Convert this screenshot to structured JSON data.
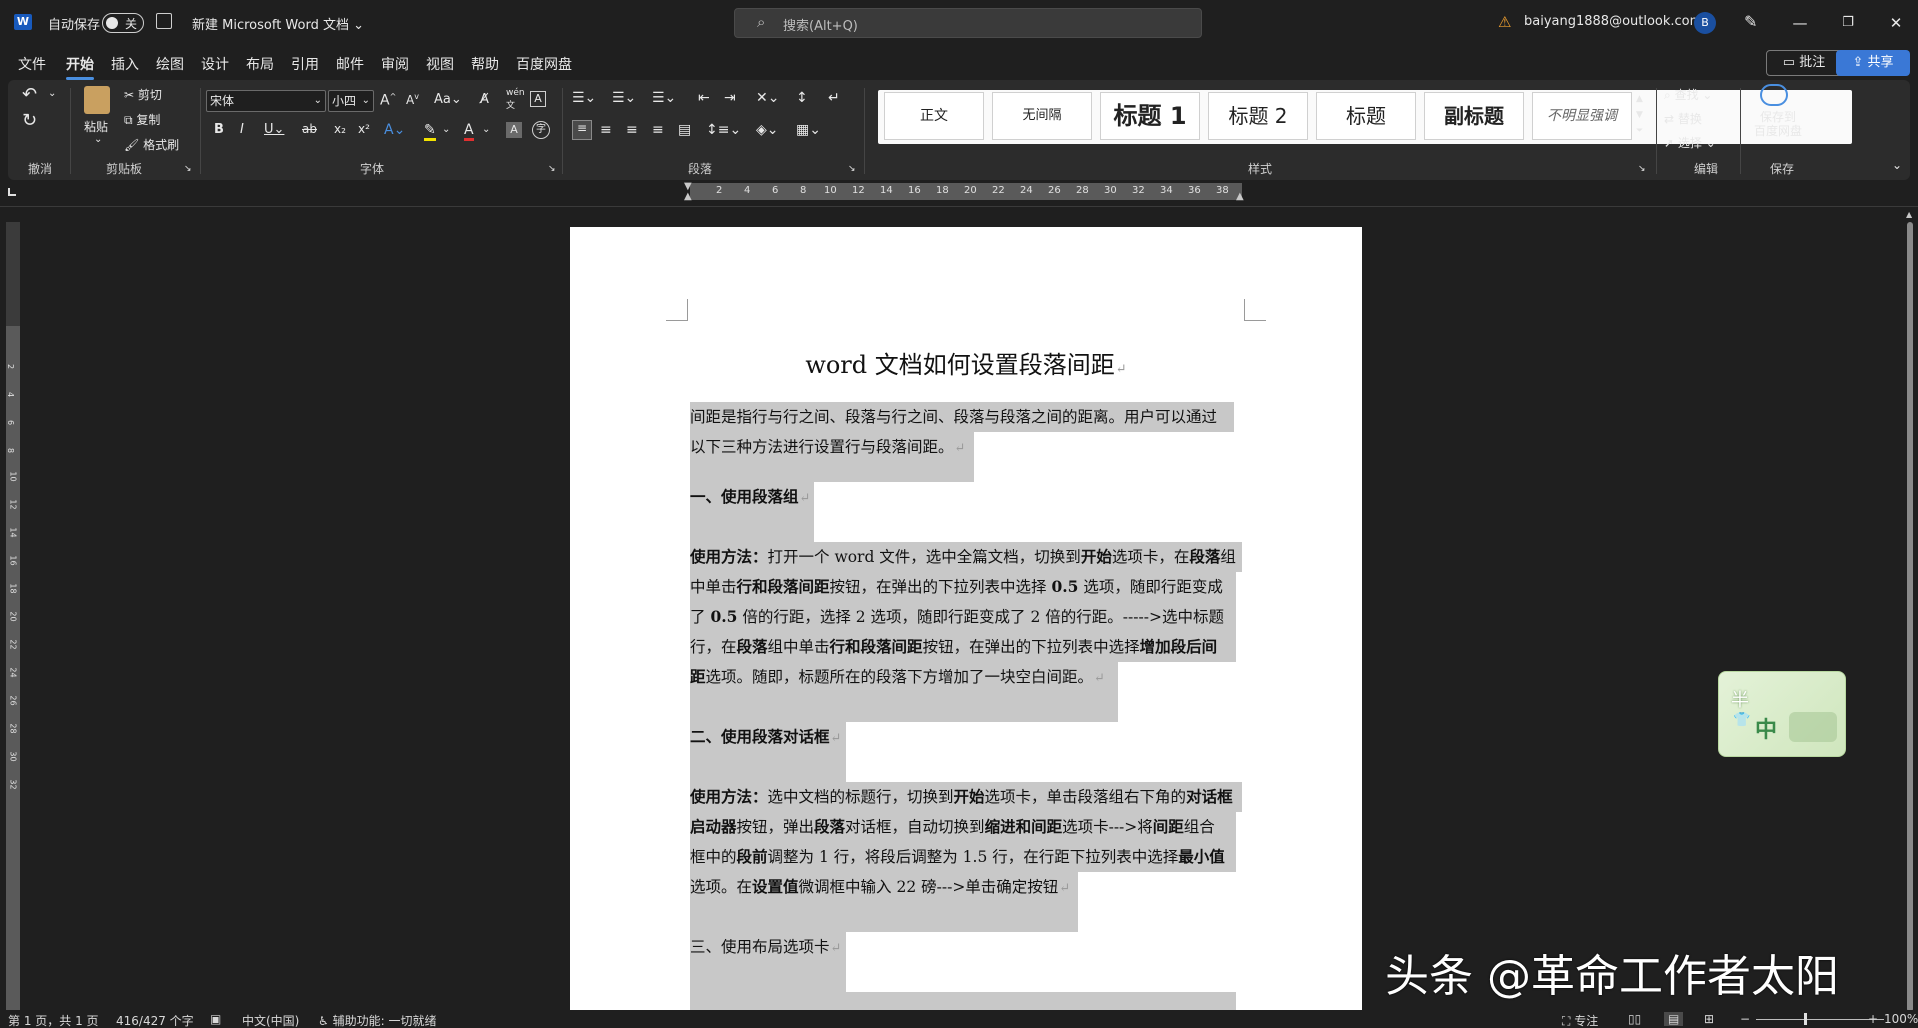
{
  "titlebar": {
    "app_badge": "W",
    "autosave_label": "自动保存",
    "autosave_state": "关",
    "doc_name": "新建 Microsoft Word 文档",
    "search_placeholder": "搜索(Alt+Q)",
    "account": "baiyang1888@outlook.com",
    "avatar_initial": "B"
  },
  "tabs": [
    "文件",
    "开始",
    "插入",
    "绘图",
    "设计",
    "布局",
    "引用",
    "邮件",
    "审阅",
    "视图",
    "帮助",
    "百度网盘"
  ],
  "active_tab": "开始",
  "actions": {
    "comment": "批注",
    "share": "共享"
  },
  "ribbon": {
    "undo_group": "撤消",
    "clipboard": {
      "paste": "粘贴",
      "cut": "剪切",
      "copy": "复制",
      "format_painter": "格式刷",
      "group": "剪贴板"
    },
    "font": {
      "font_name": "宋体",
      "font_size": "小四",
      "group": "字体"
    },
    "paragraph": {
      "group": "段落"
    },
    "styles": {
      "items": [
        "正文",
        "无间隔",
        "标题 1",
        "标题 2",
        "标题",
        "副标题",
        "不明显强调"
      ],
      "group": "样式"
    },
    "editing": {
      "find": "查找",
      "replace": "替换",
      "select": "选择",
      "group": "编辑"
    },
    "save": {
      "line1": "保存到",
      "line2": "百度网盘",
      "group": "保存"
    }
  },
  "ruler_ticks": [
    "2",
    "4",
    "6",
    "8",
    "10",
    "12",
    "14",
    "16",
    "18",
    "20",
    "22",
    "24",
    "26",
    "28",
    "30",
    "32",
    "34",
    "36",
    "38"
  ],
  "vruler_ticks": [
    "2",
    "4",
    "6",
    "8",
    "10",
    "12",
    "14",
    "16",
    "18",
    "20",
    "22",
    "24",
    "26",
    "28",
    "30",
    "32"
  ],
  "document": {
    "title": "word 文档如何设置段落间距",
    "lines": {
      "p1l1": "间距是指行与行之间、段落与行之间、段落与段落之间的距离。用户可以通过",
      "p1l2": "以下三种方法进行设置行与段落间距。",
      "h1": "一、使用段落组",
      "p2l1a": "使用方法：",
      "p2l1b": "打开一个 word 文件，选中全篇文档，切换到",
      "p2l1c": "开始",
      "p2l1d": "选项卡，在",
      "p2l1e": "段落",
      "p2l1f": "组",
      "p2l2a": "中单击",
      "p2l2b": "行和段落间距",
      "p2l2c": "按钮，在弹出的下拉列表中选择 ",
      "p2l2d": "0.5",
      "p2l2e": " 选项，随即行距变成",
      "p2l3a": "了 ",
      "p2l3b": "0.5",
      "p2l3c": " 倍的行距，选择 2 选项，随即行距变成了 2 倍的行距。----->选中标题",
      "p2l4a": "行，在",
      "p2l4b": "段落",
      "p2l4c": "组中单击",
      "p2l4d": "行和段落间距",
      "p2l4e": "按钮，在弹出的下拉列表中选择",
      "p2l4f": "增加段后间",
      "p2l5a": "距",
      "p2l5b": "选项。随即，标题所在的段落下方增加了一块空白间距。",
      "h2": "二、使用段落对话框",
      "p3l1a": "使用方法：",
      "p3l1b": "选中文档的标题行，切换到",
      "p3l1c": "开始",
      "p3l1d": "选项卡，单击段落组右下角的",
      "p3l1e": "对话框",
      "p3l2a": "启动器",
      "p3l2b": "按钮，弹出",
      "p3l2c": "段落",
      "p3l2d": "对话框，自动切换到",
      "p3l2e": "缩进和间距",
      "p3l2f": "选项卡--->将",
      "p3l2g": "间距",
      "p3l2h": "组合",
      "p3l3a": "框中的",
      "p3l3b": "段前",
      "p3l3c": "调整为 1 行，将段后调整为 1.5 行，在行距下拉列表中选择",
      "p3l3d": "最小值",
      "p3l4a": "选项。在",
      "p3l4b": "设置值",
      "p3l4c": "微调框中输入 22 磅--->单击确定按钮",
      "h3": "三、使用布局选项卡"
    }
  },
  "statusbar": {
    "page": "第 1 页，共 1 页",
    "words": "416/427 个字",
    "language": "中文(中国)",
    "accessibility": "辅助功能: 一切就绪",
    "focus": "专注",
    "zoom": "100%"
  },
  "widget": {
    "char1": "半",
    "char2": "中"
  },
  "watermark": "头条 @革命工作者太阳",
  "colors": {
    "accent": "#4a8fe0",
    "share": "#3a78d6",
    "selection": "#c8c8c8",
    "warning": "#f0a030"
  }
}
